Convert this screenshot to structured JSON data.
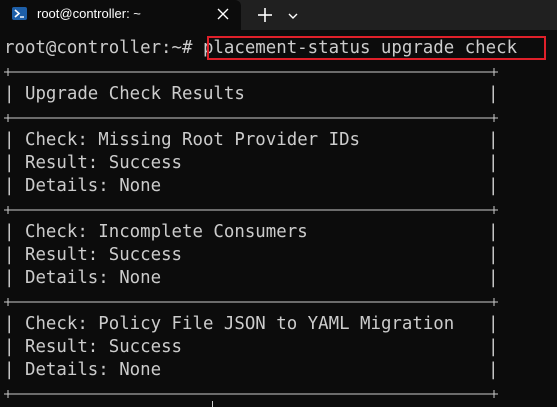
{
  "window": {
    "tab_title": "root@controller: ~",
    "tab_icon": "powershell-terminal-icon",
    "close_icon": "close-icon",
    "new_tab_icon": "plus-icon",
    "dropdown_icon": "chevron-down-icon"
  },
  "terminal": {
    "prompt": "root@controller:~# ",
    "command": "placement-status upgrade check",
    "highlight_color": "#e0202a",
    "border_char_left": "|",
    "border_char_right": "|",
    "header": "Upgrade Check Results",
    "checks": [
      {
        "check": "Check: Missing Root Provider IDs",
        "result": "Result: Success",
        "details": "Details: None"
      },
      {
        "check": "Check: Incomplete Consumers",
        "result": "Result: Success",
        "details": "Details: None"
      },
      {
        "check": "Check: Policy File JSON to YAML Migration",
        "result": "Result: Success",
        "details": "Details: None"
      }
    ]
  }
}
